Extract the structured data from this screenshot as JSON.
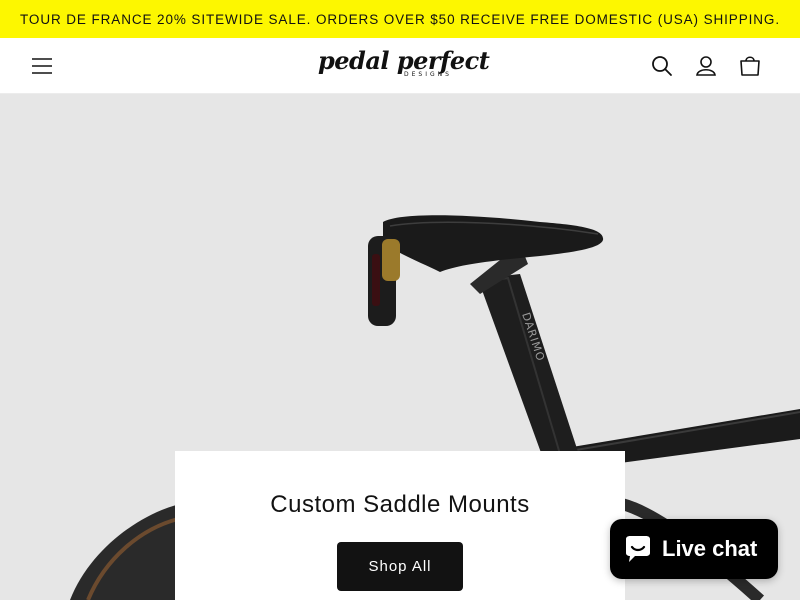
{
  "announcement": {
    "text": "TOUR DE FRANCE 20% SITEWIDE SALE. ORDERS OVER $50 RECEIVE FREE DOMESTIC (USA) SHIPPING."
  },
  "header": {
    "logo_text": "pedal perfect",
    "logo_subtext": "DESIGNS",
    "icons": [
      "menu-icon",
      "search-icon",
      "account-icon",
      "cart-icon"
    ]
  },
  "hero": {
    "product_label": "DARIMO",
    "title": "Custom Saddle Mounts",
    "button_label": "Shop All"
  },
  "chat": {
    "label": "Live chat"
  },
  "colors": {
    "announcement_bg": "#fdf700",
    "hero_bg": "#e6e6e6",
    "button_bg": "#121212",
    "chat_bg": "#000000"
  }
}
